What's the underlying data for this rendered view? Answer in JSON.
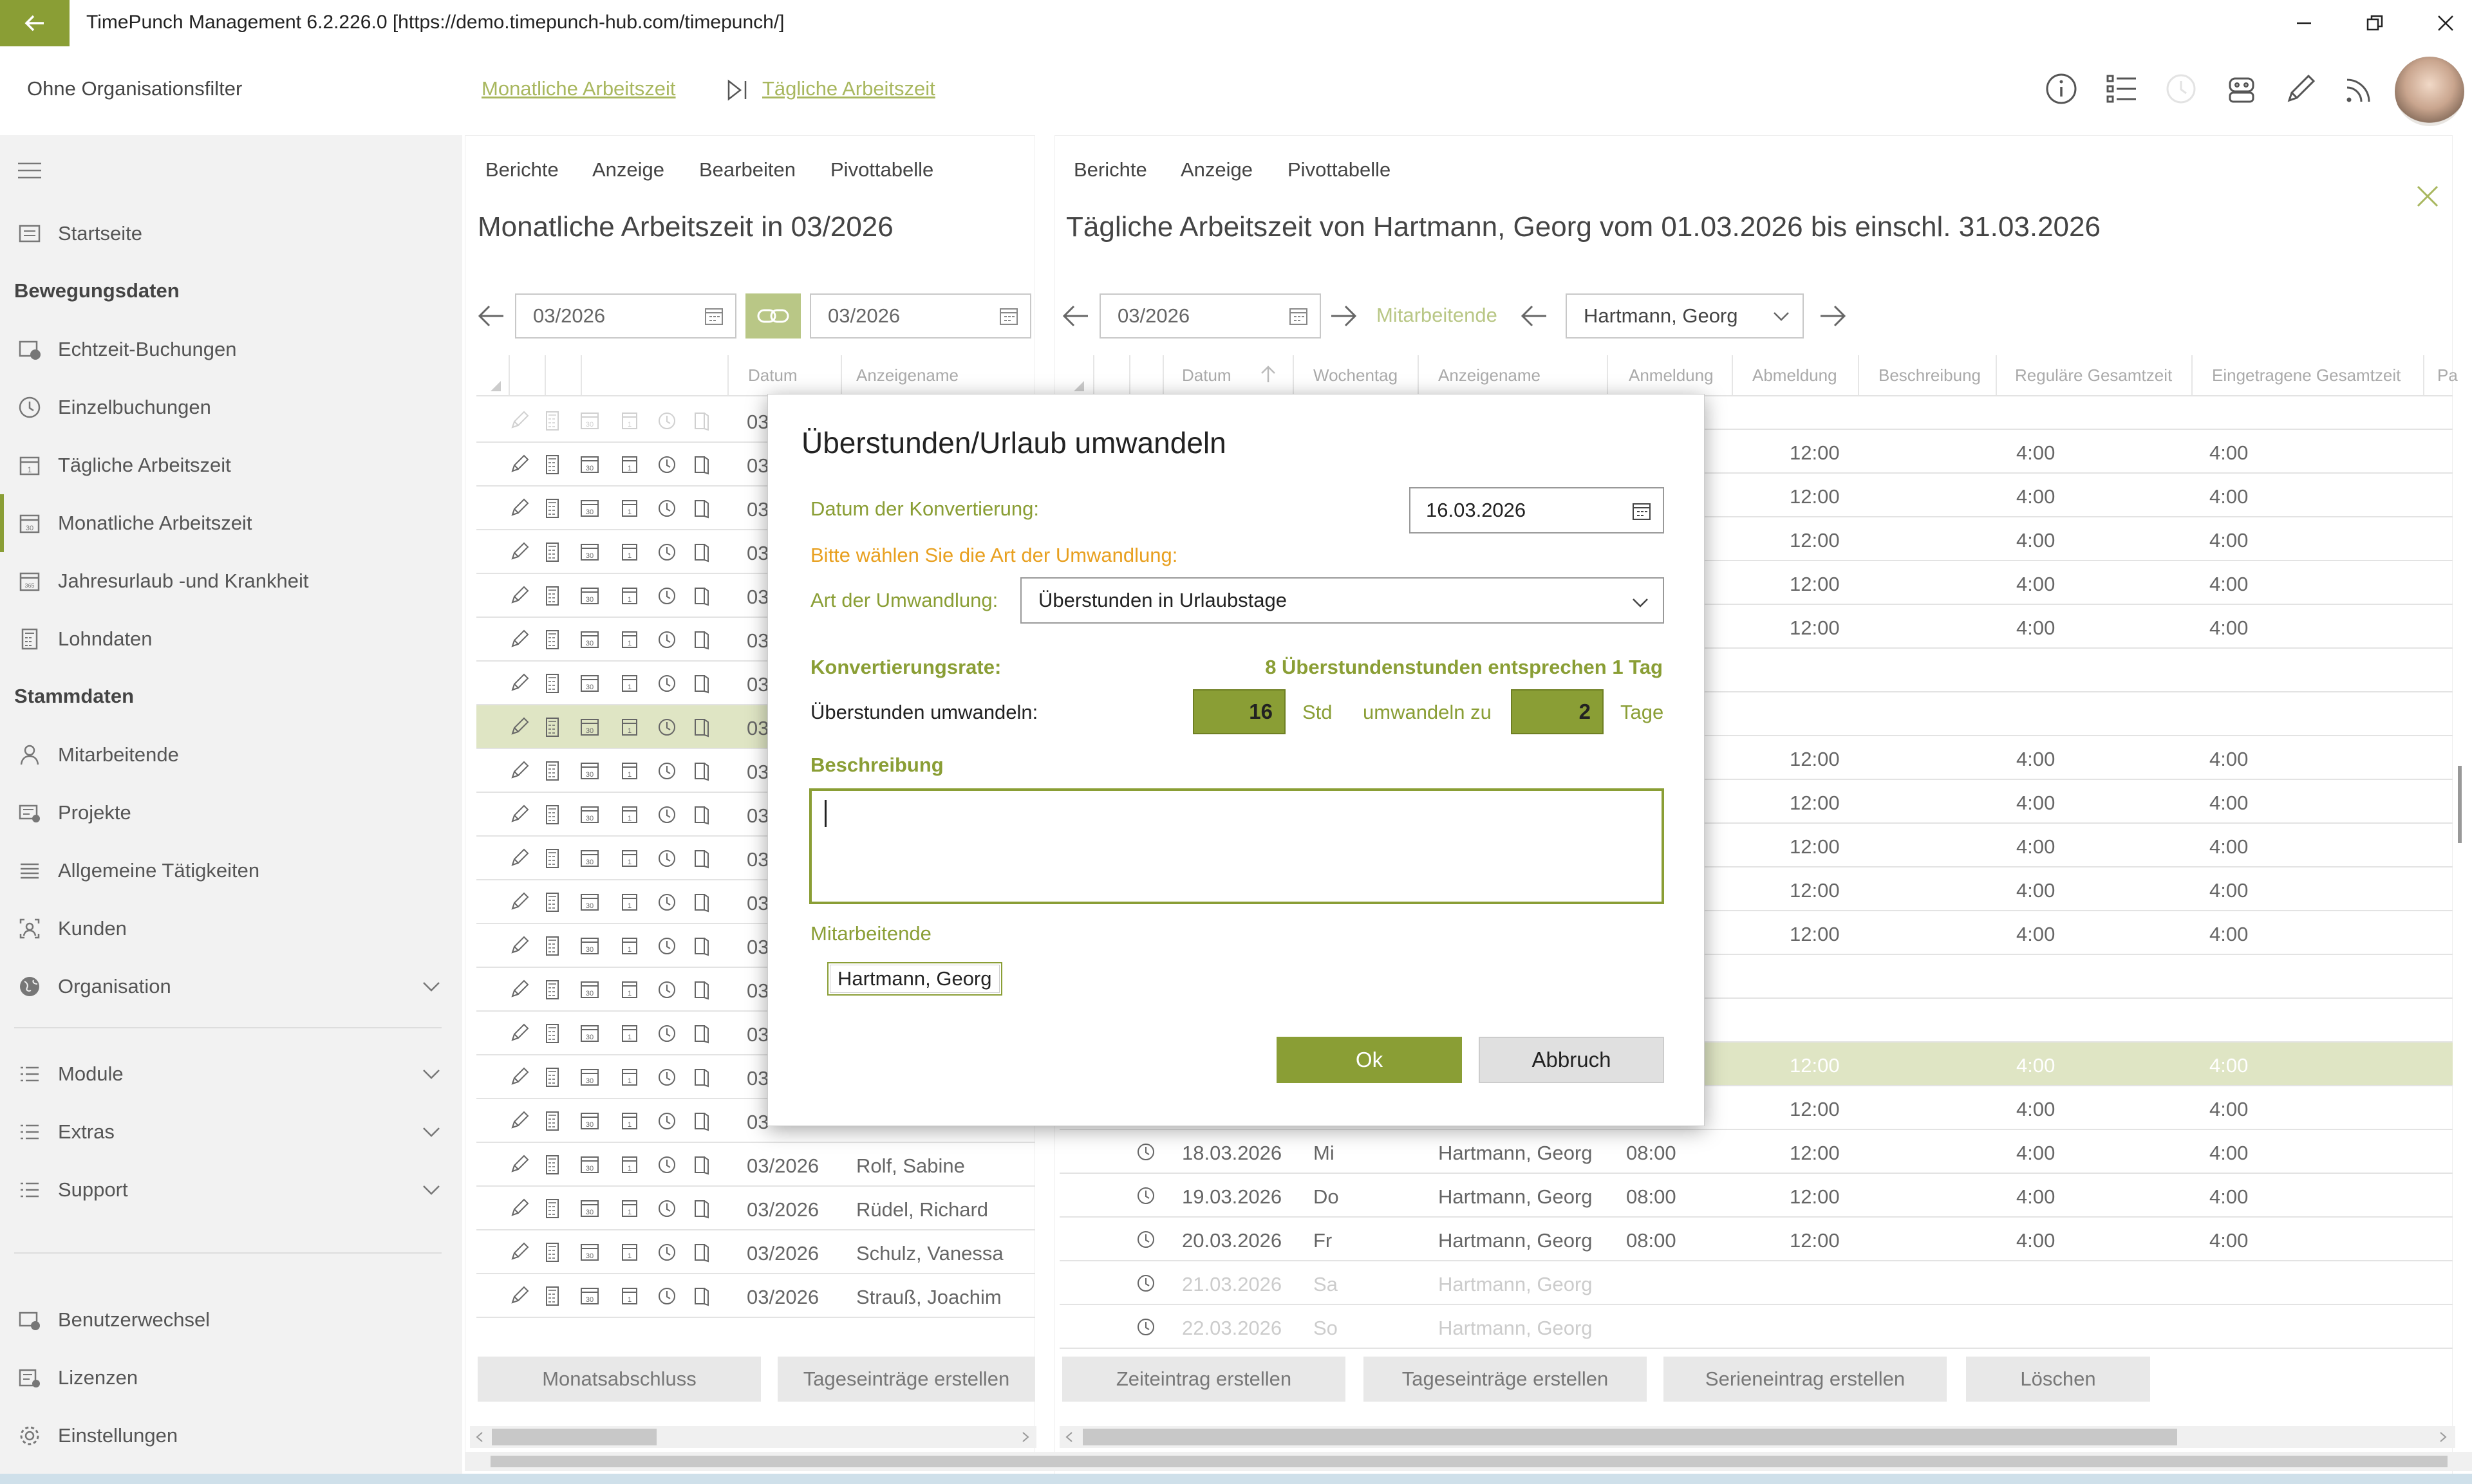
{
  "window": {
    "title": "TimePunch Management 6.2.226.0 [https://demo.timepunch-hub.com/timepunch/]"
  },
  "header": {
    "org_filter": "Ohne Organisationsfilter",
    "breadcrumb_1": "Monatliche Arbeitszeit",
    "breadcrumb_2": "Tägliche Arbeitszeit"
  },
  "sidebar": {
    "items": [
      {
        "label": "Startseite",
        "icon": "home-icon"
      },
      {
        "label": "Echtzeit-Buchungen",
        "icon": "realtime-icon"
      },
      {
        "label": "Einzelbuchungen",
        "icon": "clock-icon"
      },
      {
        "label": "Tägliche Arbeitszeit",
        "icon": "calendar-day-icon"
      },
      {
        "label": "Monatliche Arbeitszeit",
        "icon": "calendar-month-icon"
      },
      {
        "label": "Jahresurlaub -und Krankheit",
        "icon": "calendar-year-icon"
      },
      {
        "label": "Lohndaten",
        "icon": "calculator-icon"
      },
      {
        "label": "Mitarbeitende",
        "icon": "person-icon"
      },
      {
        "label": "Projekte",
        "icon": "project-icon"
      },
      {
        "label": "Allgemeine Tätigkeiten",
        "icon": "list-icon"
      },
      {
        "label": "Kunden",
        "icon": "customer-icon"
      },
      {
        "label": "Organisation",
        "icon": "globe-icon"
      },
      {
        "label": "Module",
        "icon": "list-icon"
      },
      {
        "label": "Extras",
        "icon": "list-icon"
      },
      {
        "label": "Support",
        "icon": "list-icon"
      },
      {
        "label": "Benutzerwechsel",
        "icon": "user-switch-icon"
      },
      {
        "label": "Lizenzen",
        "icon": "license-icon"
      },
      {
        "label": "Einstellungen",
        "icon": "gear-icon"
      }
    ],
    "section_bewegungsdaten": "Bewegungsdaten",
    "section_stammdaten": "Stammdaten"
  },
  "left_panel": {
    "menu": [
      "Berichte",
      "Anzeige",
      "Bearbeiten",
      "Pivottabelle"
    ],
    "title": "Monatliche Arbeitszeit in 03/2026",
    "date_from": "03/2026",
    "date_to": "03/2026",
    "col_datum": "Datum",
    "col_anzeigename": "Anzeigename",
    "rows": [
      {
        "datum": "03/2026",
        "name": "Rolf, Sabine"
      },
      {
        "datum": "03/2026",
        "name": "Rüdel, Richard"
      },
      {
        "datum": "03/2026",
        "name": "Schulz, Vanessa"
      },
      {
        "datum": "03/2026",
        "name": "Strauß, Joachim"
      }
    ],
    "row_prefix": "03",
    "btn_monatsabschluss": "Monatsabschluss",
    "btn_tageseintraege": "Tageseinträge erstellen"
  },
  "right_panel": {
    "menu": [
      "Berichte",
      "Anzeige",
      "Pivottabelle"
    ],
    "title": "Tägliche Arbeitszeit von Hartmann, Georg vom 01.03.2026 bis einschl. 31.03.2026",
    "month": "03/2026",
    "mitarbeitende_label": "Mitarbeitende",
    "employee": "Hartmann, Georg",
    "columns": [
      "Datum",
      "Wochentag",
      "Anzeigename",
      "Anmeldung",
      "Abmeldung",
      "Beschreibung",
      "Reguläre Gesamtzeit",
      "Eingetragene Gesamtzeit",
      "Pa"
    ],
    "rows": [
      {
        "datum": "18.03.2026",
        "tag": "Mi",
        "name": "Hartmann, Georg",
        "an": "08:00",
        "ab": "12:00",
        "reg": "4:00",
        "ein": "4:00"
      },
      {
        "datum": "19.03.2026",
        "tag": "Do",
        "name": "Hartmann, Georg",
        "an": "08:00",
        "ab": "12:00",
        "reg": "4:00",
        "ein": "4:00"
      },
      {
        "datum": "20.03.2026",
        "tag": "Fr",
        "name": "Hartmann, Georg",
        "an": "08:00",
        "ab": "12:00",
        "reg": "4:00",
        "ein": "4:00"
      },
      {
        "datum": "21.03.2026",
        "tag": "Sa",
        "name": "Hartmann, Georg",
        "an": "",
        "ab": "",
        "reg": "",
        "ein": ""
      },
      {
        "datum": "22.03.2026",
        "tag": "So",
        "name": "Hartmann, Georg",
        "an": "",
        "ab": "",
        "reg": "",
        "ein": ""
      }
    ],
    "bg_time_ab": "12:00",
    "bg_time_reg": "4:00",
    "btn_zeiteintrag": "Zeiteintrag erstellen",
    "btn_tageseintraege": "Tageseinträge erstellen",
    "btn_serieneintrag": "Serieneintrag erstellen",
    "btn_loeschen": "Löschen"
  },
  "dialog": {
    "title": "Überstunden/Urlaub umwandeln",
    "datum_label": "Datum der Konvertierung:",
    "datum_value": "16.03.2026",
    "hint": "Bitte wählen Sie die Art der Umwandlung:",
    "art_label": "Art der Umwandlung:",
    "art_value": "Überstunden in Urlaubstage",
    "rate_label": "Konvertierungsrate:",
    "rate_value": "8 Überstundenstunden entsprechen 1 Tag",
    "convert_label": "Überstunden umwandeln:",
    "hours_value": "16",
    "hours_unit": "Std",
    "convert_to": "umwandeln zu",
    "days_value": "2",
    "days_unit": "Tage",
    "beschreibung_label": "Beschreibung",
    "beschreibung_value": "",
    "mitarbeitende_label": "Mitarbeitende",
    "employee_chip": "Hartmann, Georg",
    "ok_label": "Ok",
    "cancel_label": "Abbruch"
  },
  "colors": {
    "accent": "#8a9e35",
    "accent_light": "#a8b75e",
    "hint_orange": "#e8a020",
    "highlight_row": "#dfe5c4"
  }
}
